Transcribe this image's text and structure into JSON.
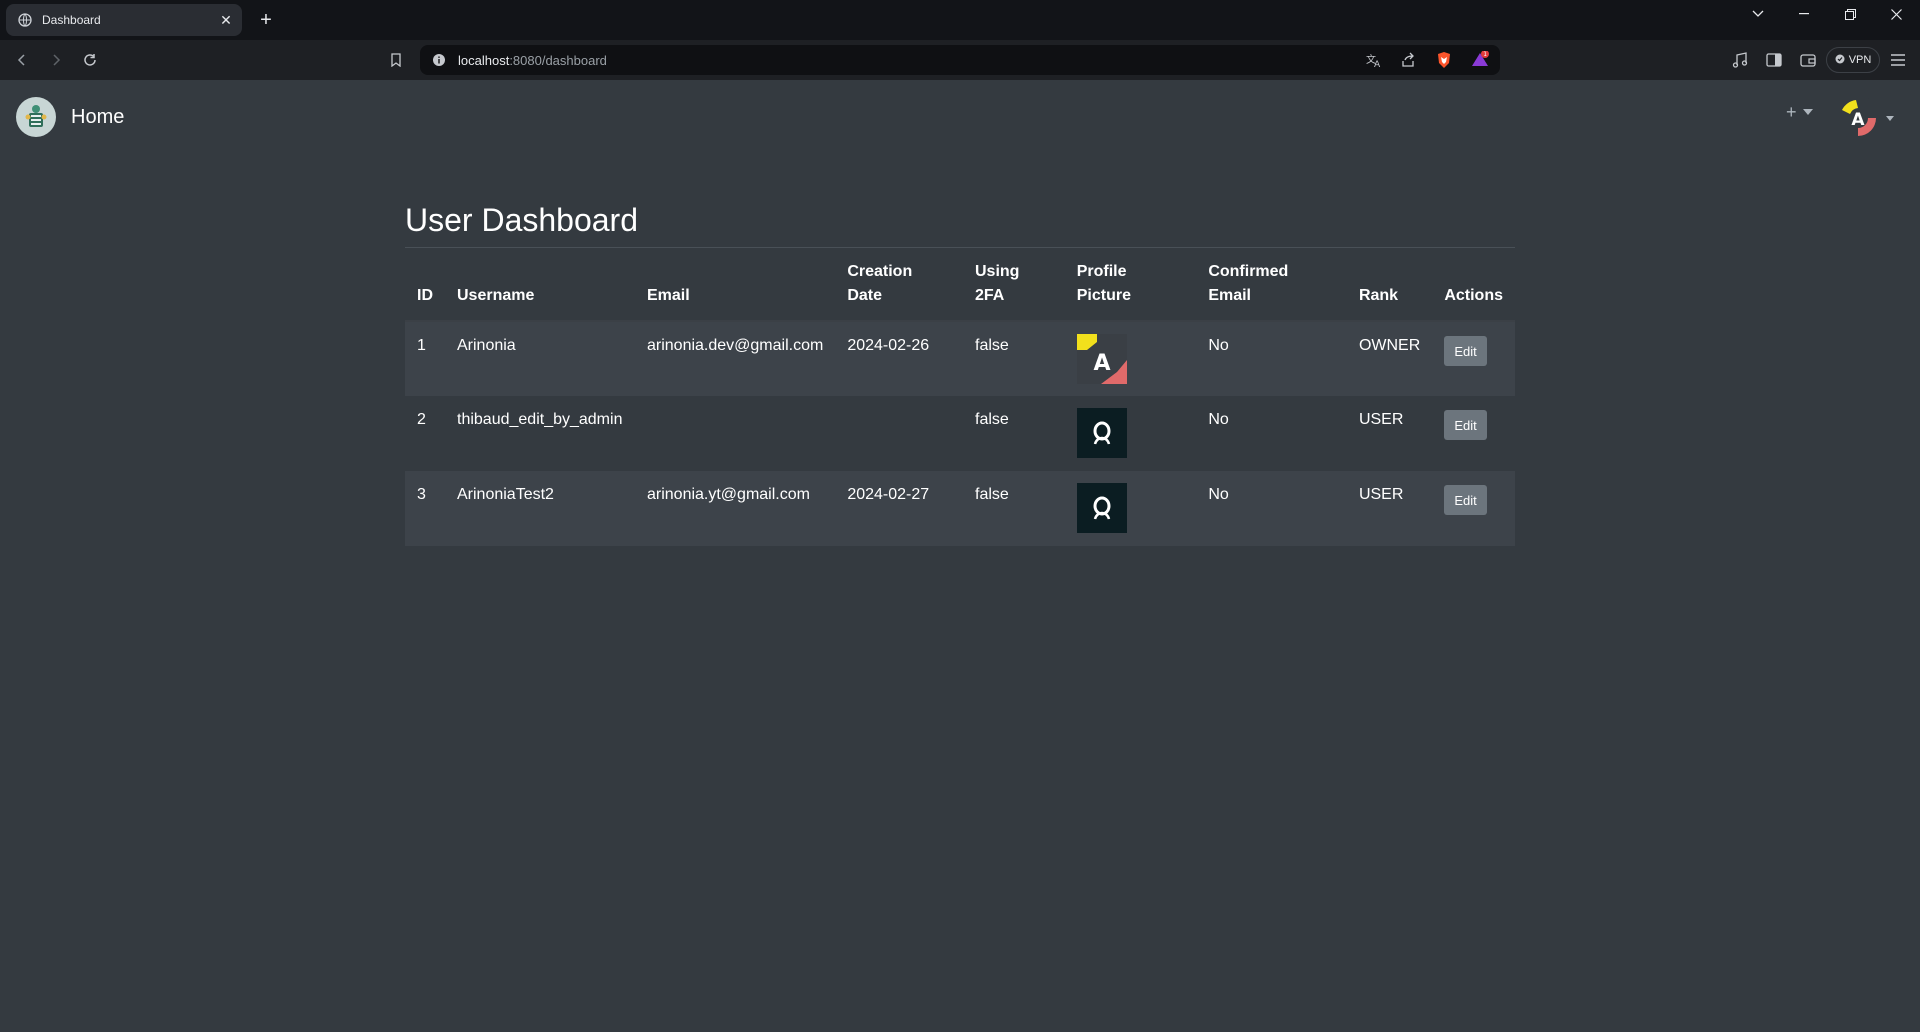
{
  "browser": {
    "tab_title": "Dashboard",
    "url_host": "localhost",
    "url_rest": ":8080/dashboard",
    "vpn_label": "VPN",
    "notification_count": "1"
  },
  "navbar": {
    "brand": "Home",
    "plus_label": "+"
  },
  "page": {
    "title": "User Dashboard"
  },
  "table": {
    "headers": {
      "id": "ID",
      "username": "Username",
      "email": "Email",
      "creation_line1": "Creation",
      "creation_line2": "Date",
      "twofa_line1": "Using",
      "twofa_line2": "2FA",
      "pfp_line1": "Profile",
      "pfp_line2": "Picture",
      "confirmed_line1": "Confirmed",
      "confirmed_line2": "Email",
      "rank": "Rank",
      "actions": "Actions"
    },
    "rows": [
      {
        "id": "1",
        "username": "Arinonia",
        "email": "arinonia.dev@gmail.com",
        "creation": "2024-02-26",
        "twofa": "false",
        "pfp": "custom-avatar",
        "confirmed": "No",
        "rank": "OWNER",
        "action": "Edit"
      },
      {
        "id": "2",
        "username": "thibaud_edit_by_admin",
        "email": "",
        "creation": "",
        "twofa": "false",
        "pfp": "default-avatar",
        "confirmed": "No",
        "rank": "USER",
        "action": "Edit"
      },
      {
        "id": "3",
        "username": "ArinoniaTest2",
        "email": "arinonia.yt@gmail.com",
        "creation": "2024-02-27",
        "twofa": "false",
        "pfp": "default-avatar",
        "confirmed": "No",
        "rank": "USER",
        "action": "Edit"
      }
    ]
  },
  "colors": {
    "page_bg": "#343a40",
    "row_stripe": "#3d434a",
    "edit_button": "#6c757d",
    "avatar_yellow": "#f2e01c",
    "avatar_red": "#e06a6a"
  }
}
